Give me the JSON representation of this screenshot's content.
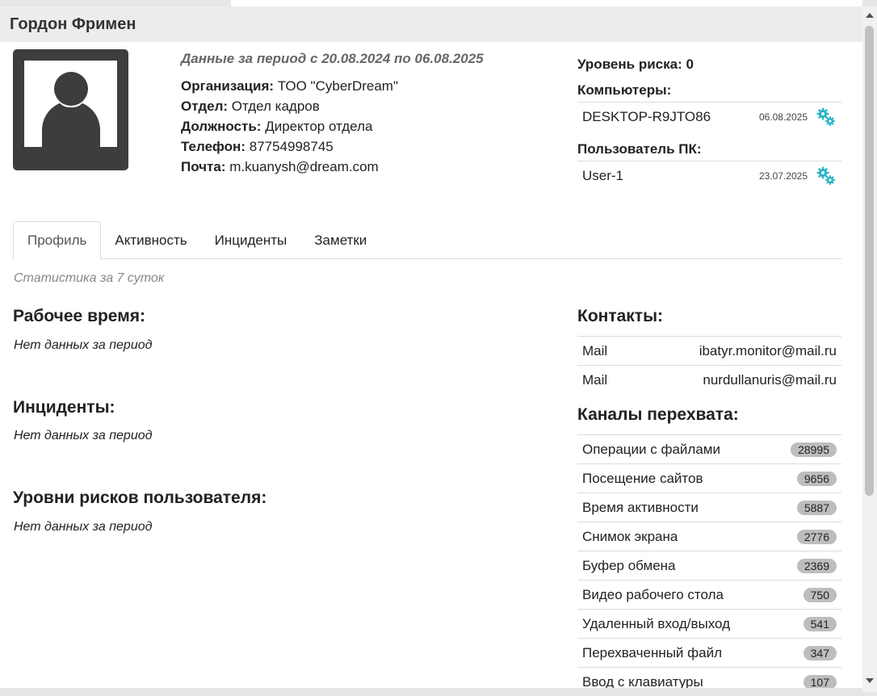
{
  "header": {
    "title": "Гордон Фримен"
  },
  "profile": {
    "period": "Данные за период с 20.08.2024 по 06.08.2025",
    "fields": [
      {
        "label": "Организация:",
        "value": "ТОО \"CyberDream\""
      },
      {
        "label": "Отдел:",
        "value": "Отдел кадров"
      },
      {
        "label": "Должность:",
        "value": "Директор отдела"
      },
      {
        "label": "Телефон:",
        "value": "87754998745"
      },
      {
        "label": "Почта:",
        "value": "m.kuanysh@dream.com"
      }
    ]
  },
  "side": {
    "risk_label": "Уровень риска: 0",
    "computers_title": "Компьютеры:",
    "computers": [
      {
        "name": "DESKTOP-R9JTO86",
        "date": "06.08.2025",
        "icon": "gears-icon"
      }
    ],
    "pc_users_title": "Пользователь ПК:",
    "pc_users": [
      {
        "name": "User-1",
        "date": "23.07.2025",
        "icon": "gears-icon"
      }
    ]
  },
  "tabs": [
    {
      "label": "Профиль",
      "active": true
    },
    {
      "label": "Активность",
      "active": false
    },
    {
      "label": "Инциденты",
      "active": false
    },
    {
      "label": "Заметки",
      "active": false
    }
  ],
  "stats_caption": "Статистика за 7 суток",
  "sections": {
    "work_time": {
      "title": "Рабочее время:",
      "empty": "Нет данных за период"
    },
    "incidents": {
      "title": "Инциденты:",
      "empty": "Нет данных за период"
    },
    "risk_levels": {
      "title": "Уровни рисков пользователя:",
      "empty": "Нет данных за период"
    }
  },
  "contacts": {
    "title": "Контакты:",
    "items": [
      {
        "type": "Mail",
        "value": "ibatyr.monitor@mail.ru"
      },
      {
        "type": "Mail",
        "value": "nurdullanuris@mail.ru"
      }
    ]
  },
  "channels": {
    "title": "Каналы перехвата:",
    "items": [
      {
        "name": "Операции с файлами",
        "count": "28995"
      },
      {
        "name": "Посещение сайтов",
        "count": "9656"
      },
      {
        "name": "Время активности",
        "count": "5887"
      },
      {
        "name": "Снимок экрана",
        "count": "2776"
      },
      {
        "name": "Буфер обмена",
        "count": "2369"
      },
      {
        "name": "Видео рабочего стола",
        "count": "750"
      },
      {
        "name": "Удаленный вход/выход",
        "count": "541"
      },
      {
        "name": "Перехваченный файл",
        "count": "347"
      },
      {
        "name": "Ввод с клавиатуры",
        "count": "107"
      }
    ]
  },
  "colors": {
    "header_bg": "#ececec",
    "avatar": "#3d3d3d",
    "gear_accent": "#26b5c6",
    "badge_bg": "#bdbdbd"
  }
}
